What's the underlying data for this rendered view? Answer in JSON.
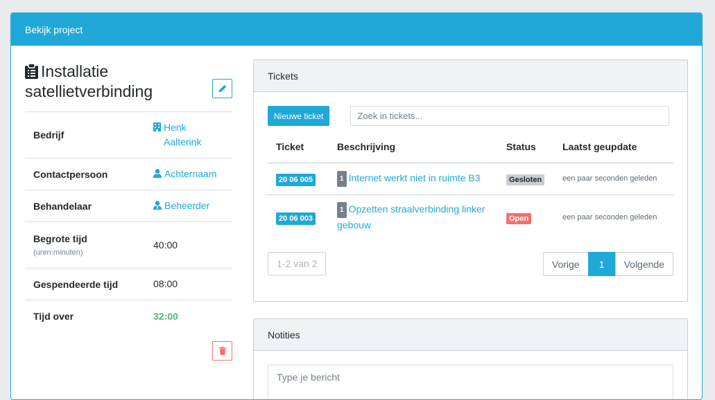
{
  "panel": {
    "title": "Bekijk project"
  },
  "project": {
    "title": "Installatie satellietverbinding",
    "fields": [
      {
        "label": "Bedrijf",
        "sublabel": "",
        "value": "Henk Aalterink",
        "icon": "building-icon"
      },
      {
        "label": "Contactpersoon",
        "sublabel": "",
        "value": "Achternaam",
        "icon": "user-icon"
      },
      {
        "label": "Behandelaar",
        "sublabel": "",
        "value": "Beheerder",
        "icon": "user-tie-icon"
      },
      {
        "label": "Begrote tijd",
        "sublabel": "(uren:minuten)",
        "value": "40:00"
      },
      {
        "label": "Gespendeerde tijd",
        "sublabel": "",
        "value": "08:00"
      },
      {
        "label": "Tijd over",
        "sublabel": "",
        "value": "32:00"
      }
    ]
  },
  "tickets": {
    "header": "Tickets",
    "new_button": "Nieuwe ticket",
    "search_placeholder": "Zoek in tickets...",
    "columns": [
      "Ticket",
      "Beschrijving",
      "Status",
      "Laatst geupdate"
    ],
    "rows": [
      {
        "id": "20 06 005",
        "count": "1",
        "description": "Internet werkt niet in ruimte B3",
        "status": "Gesloten",
        "updated": "een paar seconden geleden"
      },
      {
        "id": "20 06 003",
        "count": "1",
        "description": "Opzetten straalverbinding linker gebouw",
        "status": "Open",
        "updated": "een paar seconden geleden"
      }
    ],
    "range": "1-2 van 2",
    "pagination": {
      "prev": "Vorige",
      "current": "1",
      "next": "Volgende"
    }
  },
  "notes": {
    "header": "Notities",
    "placeholder": "Type je bericht"
  },
  "colors": {
    "primary": "#20a8d8",
    "success": "#4dbd74",
    "danger": "#f86c6b",
    "muted": "#c8ced3"
  }
}
